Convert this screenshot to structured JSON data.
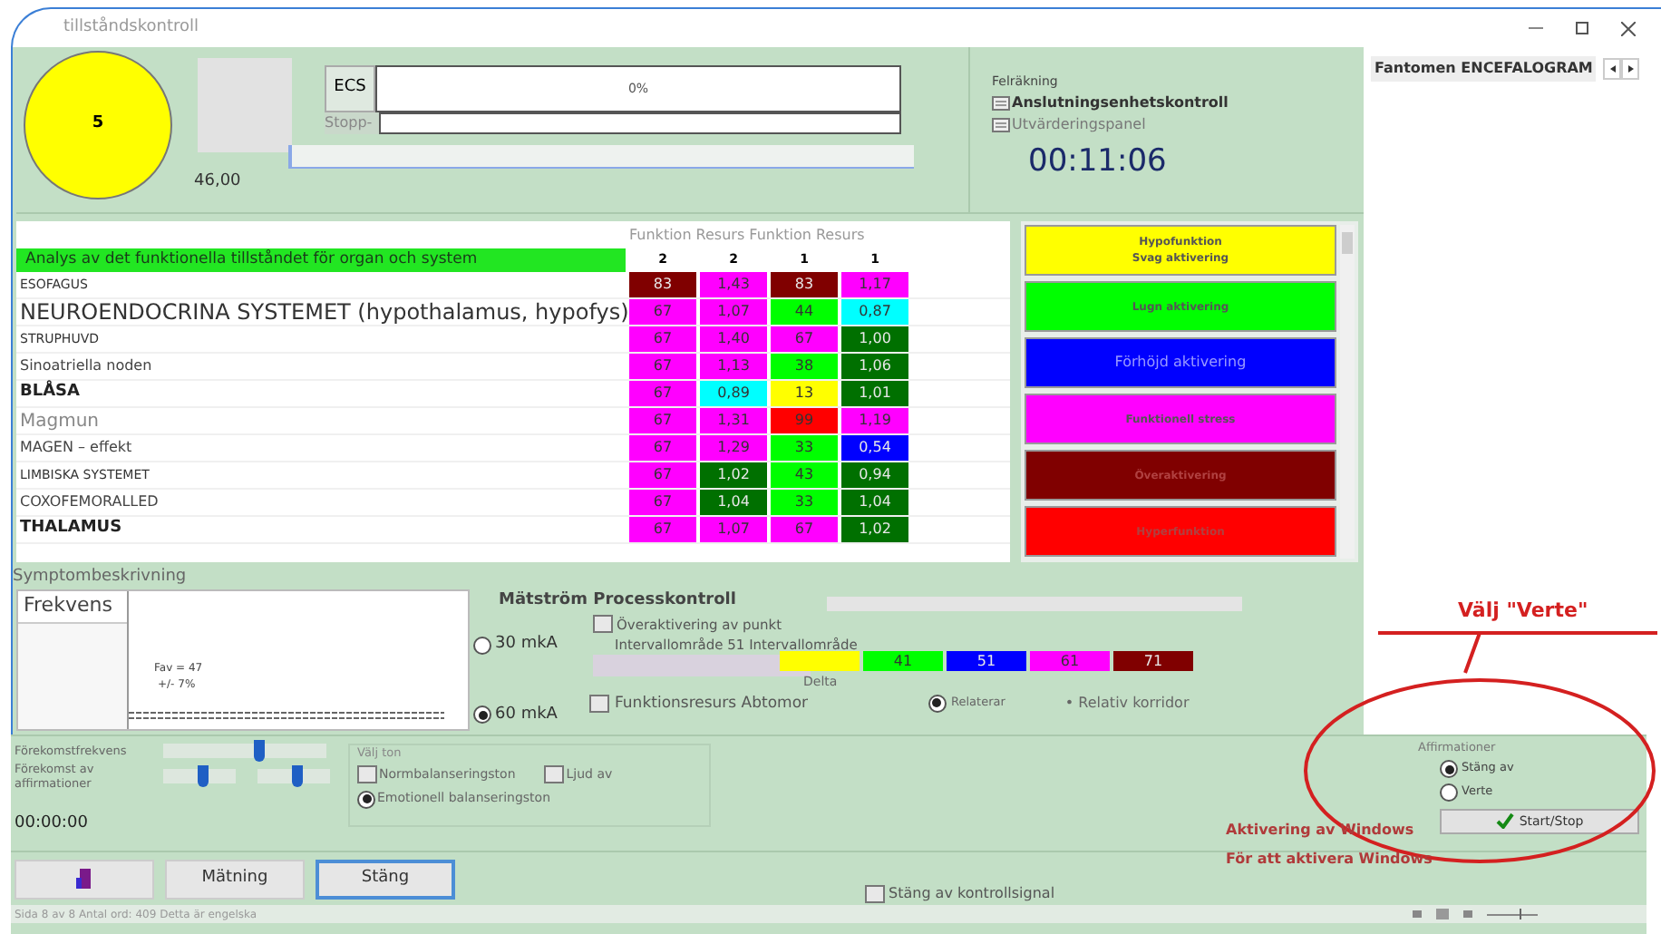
{
  "window": {
    "title": "tillståndskontroll"
  },
  "indicator": {
    "value": "5",
    "reading": "46,00"
  },
  "ecs": {
    "label": "ECS",
    "progress_text": "0%",
    "level": 0,
    "stop_label": "Stopp-"
  },
  "thin_progress": {
    "level": 0
  },
  "error_panel": {
    "title": "Felräkning",
    "items": [
      "Anslutningsenhetskontroll",
      "Utvärderingspanel"
    ],
    "timer": "00:11:06"
  },
  "table": {
    "header": "Funktion Resurs Funktion Resurs",
    "heading": "Analys av det funktionella tillståndet för organ och system",
    "column_marks": [
      "2",
      "2",
      "1",
      "1"
    ],
    "rows": [
      {
        "name": "ESOFAGUS",
        "kind": "small",
        "cells": [
          {
            "text": "83",
            "color": "#800000"
          },
          {
            "text": "1,43",
            "color": "#ff00ff"
          },
          {
            "text": "83",
            "color": "#800000"
          },
          {
            "text": "1,17",
            "color": "#ff00ff"
          }
        ]
      },
      {
        "name": "NEUROENDOCRINA SYSTEMET (hypothalamus, hypofys)",
        "kind": "large",
        "cells": [
          {
            "text": "67",
            "color": "#ff00ff"
          },
          {
            "text": "1,07",
            "color": "#ff00ff"
          },
          {
            "text": "44",
            "color": "#00ff00"
          },
          {
            "text": "0,87",
            "color": "#00ffff"
          }
        ]
      },
      {
        "name": "STRUPHUVD",
        "kind": "small",
        "cells": [
          {
            "text": "67",
            "color": "#ff00ff"
          },
          {
            "text": "1,40",
            "color": "#ff00ff"
          },
          {
            "text": "67",
            "color": "#ff00ff"
          },
          {
            "text": "1,00",
            "color": "#007000"
          }
        ]
      },
      {
        "name": "Sinoatriella noden",
        "kind": "normal",
        "cells": [
          {
            "text": "67",
            "color": "#ff00ff"
          },
          {
            "text": "1,13",
            "color": "#ff00ff"
          },
          {
            "text": "38",
            "color": "#00ff00"
          },
          {
            "text": "1,06",
            "color": "#007000"
          }
        ]
      },
      {
        "name": "BLÅSA",
        "kind": "bold",
        "cells": [
          {
            "text": "67",
            "color": "#ff00ff"
          },
          {
            "text": "0,89",
            "color": "#00ffff"
          },
          {
            "text": "13",
            "color": "#ffff00"
          },
          {
            "text": "1,01",
            "color": "#007000"
          }
        ]
      },
      {
        "name": "Magmun",
        "kind": "light",
        "cells": [
          {
            "text": "67",
            "color": "#ff00ff"
          },
          {
            "text": "1,31",
            "color": "#ff00ff"
          },
          {
            "text": "99",
            "color": "#ff0000"
          },
          {
            "text": "1,19",
            "color": "#ff00ff"
          }
        ]
      },
      {
        "name": "MAGEN – effekt",
        "kind": "normal",
        "cells": [
          {
            "text": "67",
            "color": "#ff00ff"
          },
          {
            "text": "1,29",
            "color": "#ff00ff"
          },
          {
            "text": "33",
            "color": "#00ff00"
          },
          {
            "text": "0,54",
            "color": "#0000ff"
          }
        ]
      },
      {
        "name": "LIMBISKA SYSTEMET",
        "kind": "small",
        "cells": [
          {
            "text": "67",
            "color": "#ff00ff"
          },
          {
            "text": "1,02",
            "color": "#007000"
          },
          {
            "text": "43",
            "color": "#00ff00"
          },
          {
            "text": "0,94",
            "color": "#007000"
          }
        ]
      },
      {
        "name": "COXOFEMORALLED",
        "kind": "normal",
        "cells": [
          {
            "text": "67",
            "color": "#ff00ff"
          },
          {
            "text": "1,04",
            "color": "#007000"
          },
          {
            "text": "33",
            "color": "#00ff00"
          },
          {
            "text": "1,04",
            "color": "#007000"
          }
        ]
      },
      {
        "name": "THALAMUS",
        "kind": "bold",
        "cells": [
          {
            "text": "67",
            "color": "#ff00ff"
          },
          {
            "text": "1,07",
            "color": "#ff00ff"
          },
          {
            "text": "67",
            "color": "#ff00ff"
          },
          {
            "text": "1,02",
            "color": "#007000"
          }
        ]
      }
    ]
  },
  "legend": [
    {
      "labels": [
        "Hypofunktion",
        "Svag aktivering"
      ],
      "color": "#ffff00"
    },
    {
      "labels": [
        "Lugn aktivering"
      ],
      "color": "#00ff00"
    },
    {
      "labels": [
        "Förhöjd aktivering"
      ],
      "color": "#0000ff"
    },
    {
      "labels": [
        "Funktionell stress"
      ],
      "color": "#ff00ff"
    },
    {
      "labels": [
        "Överaktivering"
      ],
      "color": "#800000"
    },
    {
      "labels": [
        "Hyperfunktion"
      ],
      "color": "#ff0000"
    }
  ],
  "right_panel": {
    "tab": "Fantomen ENCEFALOGRAM"
  },
  "symptom": {
    "title": "Symptombeskrivning",
    "tab": "Frekvens",
    "fav": "Fav = 47",
    "spread": "+/-  7%"
  },
  "process": {
    "title": "Mätström Processkontroll",
    "progress": {
      "level": 0
    },
    "currents": [
      {
        "label": "30 mkA",
        "selected": false
      },
      {
        "label": "60 mkA",
        "selected": true
      }
    ],
    "overactivation": {
      "label": "Överaktivering av punkt",
      "checked": false
    },
    "interval_label": "Intervallområde 51 Intervallområde",
    "swatches": [
      {
        "color": "#ffff00"
      },
      {
        "text": "41",
        "color": "#00ff00"
      },
      {
        "text": "51",
        "color": "#0000ff"
      },
      {
        "text": "61",
        "color": "#ff00ff"
      },
      {
        "text": "71",
        "color": "#800000"
      }
    ],
    "delta": "Delta",
    "function_check": {
      "label": "Funktionsresurs Abtomor",
      "checked": false
    },
    "relates": {
      "label": "Relaterar",
      "selected": true
    },
    "corridor": "• Relativ korridor"
  },
  "sliders": [
    {
      "label": "Förekomstfrekvens",
      "controls": [
        {
          "level": 0.6
        }
      ]
    },
    {
      "label": "Förekomst av affirmationer",
      "controls": [
        {
          "level": 0.55
        },
        {
          "level": 0.55
        }
      ]
    }
  ],
  "tone": {
    "title": "Välj ton",
    "options": [
      {
        "label": "Normbalanseringston",
        "kind": "checkbox",
        "checked": false
      },
      {
        "label": "Ljud av",
        "kind": "checkbox",
        "checked": false
      },
      {
        "label": "Emotionell balanseringston",
        "kind": "radio",
        "checked": true
      }
    ]
  },
  "timer": "00:00:00",
  "buttons": [
    {
      "kind": "icon",
      "selected": false
    },
    {
      "label": "Mätning",
      "kind": "text",
      "selected": false
    },
    {
      "label": "Stäng",
      "kind": "text",
      "selected": true
    }
  ],
  "control_signal": {
    "label": "Stäng av kontrollsignal",
    "checked": false
  },
  "affirmations": {
    "title": "Affirmationer",
    "options": [
      {
        "label": "Stäng av",
        "selected": true
      },
      {
        "label": "Verte",
        "selected": false
      }
    ],
    "button": "Start/Stop"
  },
  "annotation": "Välj \"Verte\"",
  "activation_notice": [
    "Aktivering av Windows",
    "För att aktivera Windows"
  ],
  "status_bar": "Sida 8 av 8 Antal ord: 409 Detta är engelska",
  "zoom": {
    "level": 0.65
  }
}
